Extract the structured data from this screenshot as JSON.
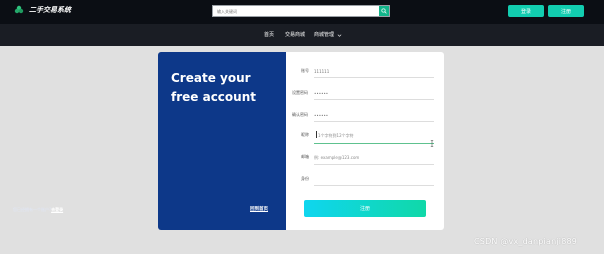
{
  "header": {
    "logo_text": "二手交易系统",
    "search": {
      "placeholder": "输入关键词"
    },
    "login_label": "登录",
    "register_label": "注册"
  },
  "nav": {
    "items": [
      {
        "label": "首页"
      },
      {
        "label": "交易商城"
      },
      {
        "label": "商城管理",
        "has_dropdown": true
      }
    ]
  },
  "promo": {
    "title": "Create your free account",
    "already_text": "您已经拥有一个账户?",
    "login_link": "去登录",
    "back_home": "回到首页"
  },
  "form": {
    "fields": [
      {
        "label": "账号",
        "value": "111111",
        "placeholder": ""
      },
      {
        "label": "设置密码",
        "value": "••••••",
        "placeholder": ""
      },
      {
        "label": "确认密码",
        "value": "••••••",
        "placeholder": ""
      },
      {
        "label": "昵称",
        "value": "",
        "placeholder": "1个字符到12个字符",
        "active": true
      },
      {
        "label": "邮箱",
        "value": "",
        "placeholder": "例: example@123.com"
      },
      {
        "label": "身份",
        "value": "",
        "placeholder": ""
      }
    ],
    "submit_label": "注册"
  },
  "watermark": "CSDN @vx_danpianji889",
  "colors": {
    "header_bg": "#0b0e14",
    "nav_bg": "#1a1d24",
    "accent": "#12cdb0",
    "promo_bg": "#0d3889",
    "page_bg": "#e0e0e0"
  }
}
